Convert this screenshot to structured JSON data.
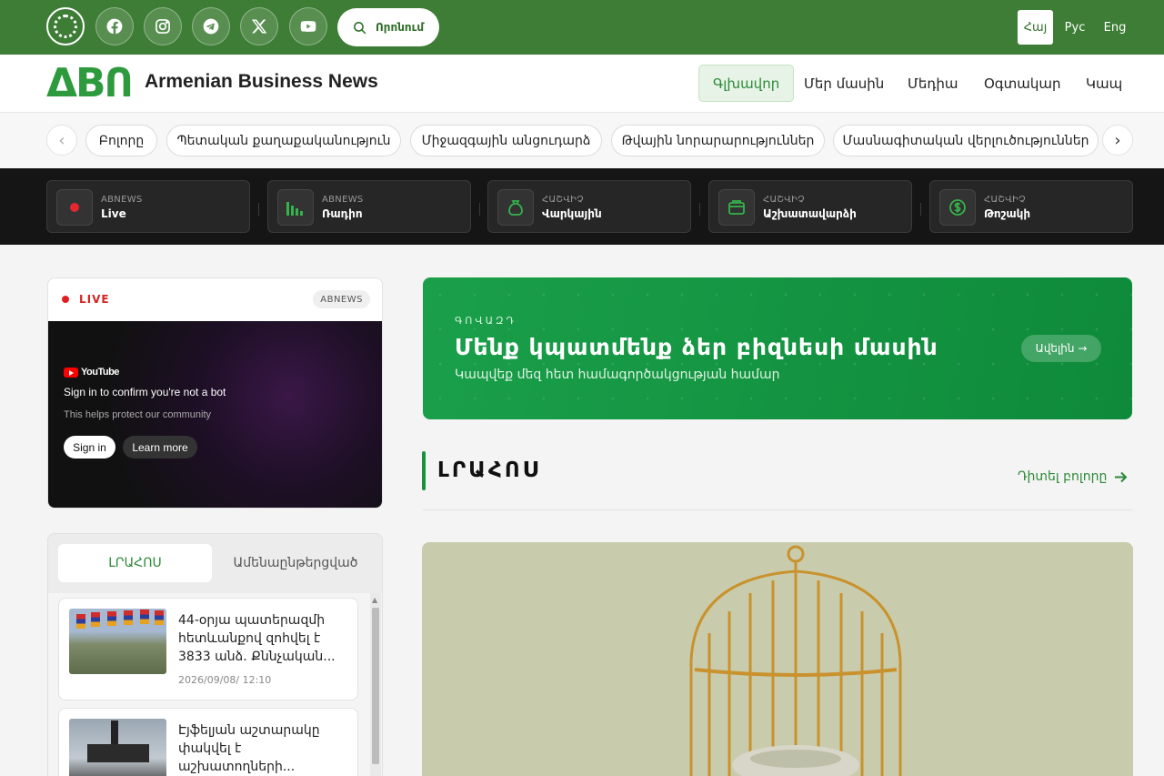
{
  "topbar": {
    "search_label": "Որոնում",
    "languages": [
      "Հայ",
      "Рус",
      "Eng"
    ],
    "active_language": "Հայ",
    "colors": {
      "bar": "#3d7d35"
    }
  },
  "header": {
    "logo_text": "ΔBՈ",
    "site_name": "Armenian Business News",
    "nav": [
      "Գլխավոր",
      "Մեր մասին",
      "Մեդիա",
      "Օգտակար",
      "Կապ"
    ]
  },
  "categories": [
    "Բոլորը",
    "Պետական քաղաքականություն",
    "Միջազգային անցուդարձ",
    "Թվային նորարարություններ",
    "Մասնագիտական վերլուծություններ"
  ],
  "quicklinks": [
    {
      "small": "ABNEWS",
      "big": "Live",
      "icon": "live-record-icon"
    },
    {
      "small": "ABNEWS",
      "big": "Ռադիո",
      "icon": "radio-bars-icon"
    },
    {
      "small": "ՀԱՇՎԻՉ",
      "big": "Վարկային",
      "icon": "money-bag-icon"
    },
    {
      "small": "ՀԱՇՎԻՉ",
      "big": "Աշխատավարձի",
      "icon": "wallet-icon"
    },
    {
      "small": "ՀԱՇՎԻՉ",
      "big": "Թոշակի",
      "icon": "dollar-coin-icon"
    }
  ],
  "live": {
    "label": "LIVE",
    "badge": "ABNEWS",
    "video": {
      "brand": "YouTube",
      "line1": "Sign in to confirm you're not a bot",
      "line2": "This helps protect our community",
      "signin": "Sign in",
      "learn_more": "Learn more"
    }
  },
  "latest_list": {
    "tabs": [
      "ԼՐԱՀՈՍ",
      "Ամենաընթերցված"
    ],
    "items": [
      {
        "title": "44-օրյա պատերազմի հետևանքով զոհվել է 3833 անձ․ Քննչական...",
        "date": "2026/09/08/ 12:10"
      },
      {
        "title": "Էյֆելյան աշտարակը փակվել է աշխատողների...",
        "date": ""
      }
    ]
  },
  "promo": {
    "kicker": "ԳՈՎԱԶԴ",
    "title": "Մենք կպատմենք ձեր բիզնեսի մասին",
    "subtitle": "Կապվեք մեզ հետ համագործակցության համար",
    "button": "Ավելին →"
  },
  "section": {
    "title": "ԼՐԱՀՈՍ",
    "link": "Դիտել բոլորը"
  }
}
